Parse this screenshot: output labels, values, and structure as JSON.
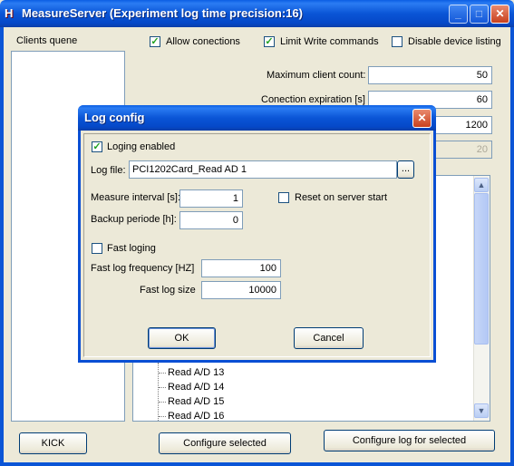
{
  "window": {
    "title": "MeasureServer (Experiment log time precision:16)",
    "app_icon": "H",
    "minimize_glyph": "_",
    "maximize_glyph": "□",
    "close_glyph": "✕"
  },
  "clients": {
    "label": "Clients quene"
  },
  "options": {
    "allow_connections": {
      "label": "Allow conections",
      "checked": true
    },
    "limit_write": {
      "label": "Limit Write commands",
      "checked": true
    },
    "disable_listing": {
      "label": "Disable device listing",
      "checked": false
    }
  },
  "settings": {
    "max_clients_label": "Maximum client count:",
    "max_clients_value": "50",
    "expiration_label": "Conection expiration [s]",
    "expiration_value": "60",
    "third_value": "1200",
    "fourth_value": "20"
  },
  "tree": {
    "items": [
      "Read A/D 13",
      "Read A/D 14",
      "Read A/D 15",
      "Read A/D 16"
    ]
  },
  "bottom_buttons": {
    "kick": "KICK",
    "configure_selected": "Configure selected",
    "configure_log": "Configure log for selected"
  },
  "dialog": {
    "title": "Log config",
    "close_glyph": "✕",
    "loging_enabled": {
      "label": "Loging enabled",
      "checked": true
    },
    "log_file_label": "Log file:",
    "log_file_value": "PCI1202Card_Read AD 1",
    "browse_label": "...",
    "measure_interval_label": "Measure interval [s]:",
    "measure_interval_value": "1",
    "backup_period_label": "Backup periode [h]:",
    "backup_period_value": "0",
    "reset_on_start": {
      "label": "Reset on server start",
      "checked": false
    },
    "fast_loging": {
      "label": "Fast loging",
      "checked": false
    },
    "fast_log_freq_label": "Fast log frequency [HZ]",
    "fast_log_freq_value": "100",
    "fast_log_size_label": "Fast log size",
    "fast_log_size_value": "10000",
    "ok_label": "OK",
    "cancel_label": "Cancel"
  },
  "check_glyph": "✓"
}
